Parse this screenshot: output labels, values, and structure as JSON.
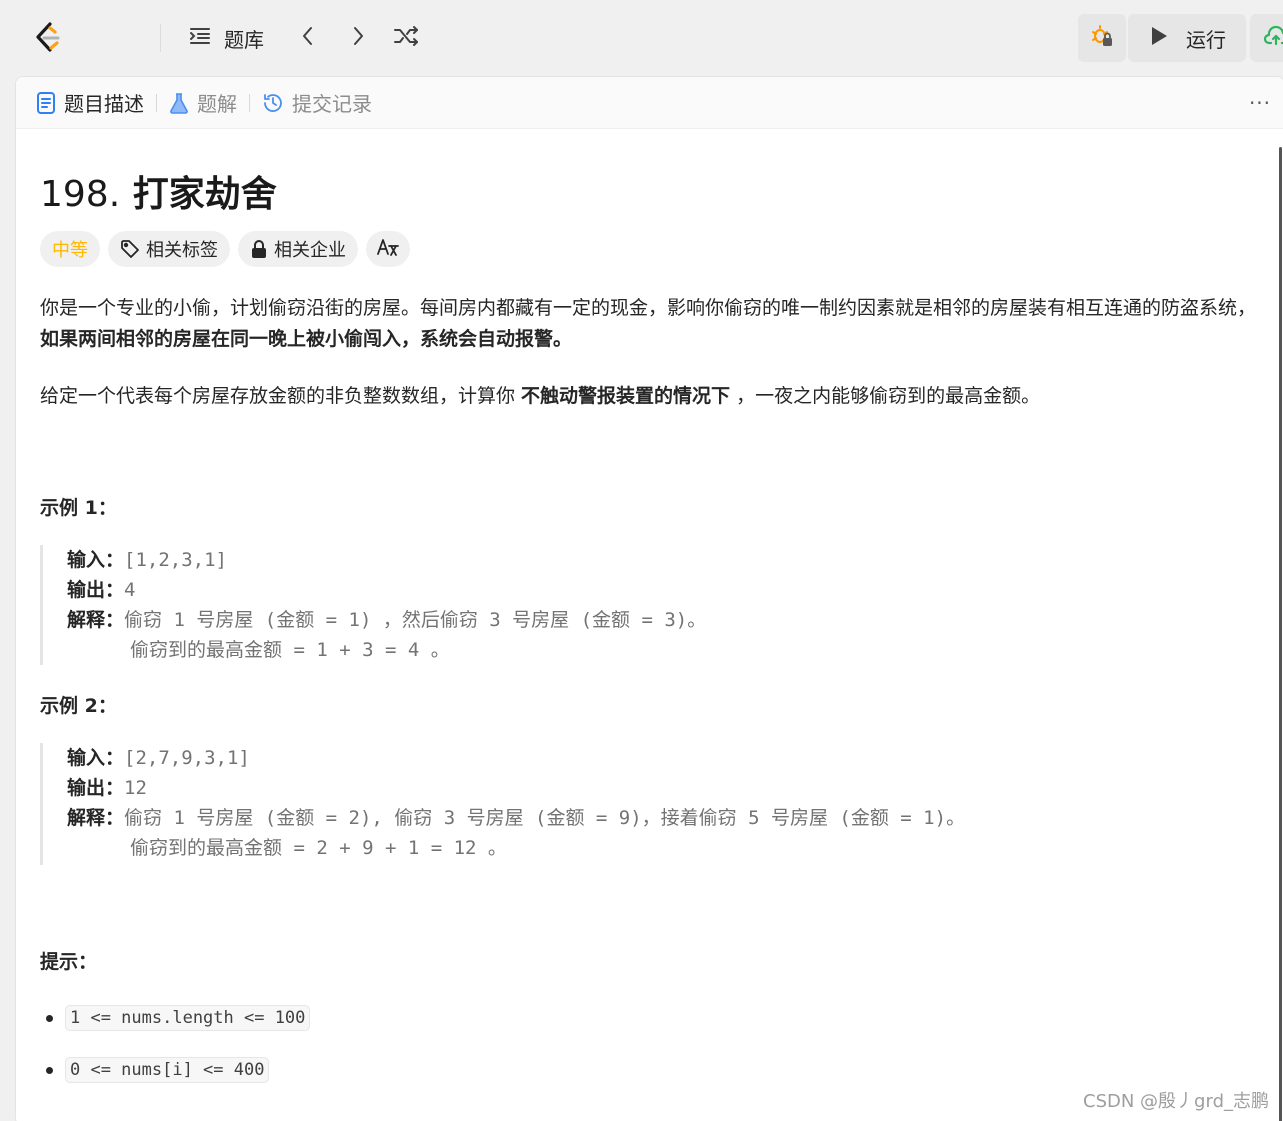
{
  "topbar": {
    "problems_label": "题库",
    "run_label": "运行",
    "icons": [
      "leetcode-logo",
      "list-icon",
      "chevron-left-icon",
      "chevron-right-icon",
      "shuffle-icon",
      "debug-icon",
      "play-icon",
      "upload-cloud-icon"
    ]
  },
  "tabs": [
    {
      "label": "题目描述",
      "icon": "document-icon",
      "active": true
    },
    {
      "label": "题解",
      "icon": "flask-icon",
      "active": false
    },
    {
      "label": "提交记录",
      "icon": "history-icon",
      "active": false
    }
  ],
  "more": "···",
  "problem": {
    "number": "198.",
    "title": "打家劫舍",
    "difficulty": "中等",
    "tags": {
      "related_tags": "相关标签",
      "related_companies": "相关企业",
      "translate": "A̅"
    },
    "desc1_a": "你是一个专业的小偷，计划偷窃沿街的房屋。每间房内都藏有一定的现金，影响你偷窃的唯一制约因素就是相邻的房屋装有相互连通的防盗系统，",
    "desc1_b": "如果两间相邻的房屋在同一晚上被小偷闯入，系统会自动报警",
    "desc1_c": "。",
    "desc2_a": "给定一个代表每个房屋存放金额的非负整数数组，计算你 ",
    "desc2_b": "不触动警报装置的情况下",
    "desc2_c": " ，一夜之内能够偷窃到的最高金额。"
  },
  "examples": [
    {
      "heading": "示例 1：",
      "input_k": "输入：",
      "input_v": "[1,2,3,1]",
      "output_k": "输出：",
      "output_v": "4",
      "explain_k": "解释：",
      "explain_v1": "偷窃 1 号房屋 (金额 = 1) ，然后偷窃 3 号房屋 (金额 = 3)。",
      "explain_v2": "偷窃到的最高金额 = 1 + 3 = 4 。"
    },
    {
      "heading": "示例 2：",
      "input_k": "输入：",
      "input_v": "[2,7,9,3,1]",
      "output_k": "输出：",
      "output_v": "12",
      "explain_k": "解释：",
      "explain_v1": "偷窃 1 号房屋 (金额 = 2), 偷窃 3 号房屋 (金额 = 9)，接着偷窃 5 号房屋 (金额 = 1)。",
      "explain_v2": "偷窃到的最高金额 = 2 + 9 + 1 = 12 。"
    }
  ],
  "tips": {
    "heading": "提示：",
    "items": [
      "1 <= nums.length <= 100",
      "0 <= nums[i] <= 400"
    ]
  },
  "watermark": "CSDN @殷丿grd_志鹏"
}
